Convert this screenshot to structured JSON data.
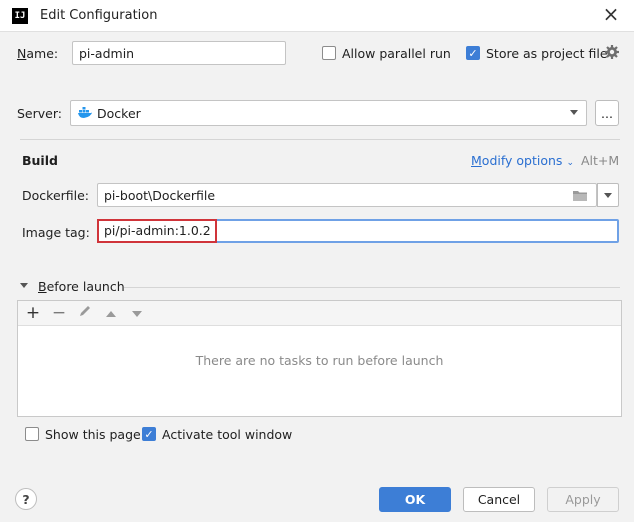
{
  "window": {
    "title": "Edit Configuration",
    "app_icon_text": "IJ"
  },
  "name": {
    "label": "Name:",
    "value": "pi-admin"
  },
  "options": {
    "allow_parallel": {
      "label": "Allow parallel run",
      "checked": false
    },
    "store_as_project_file": {
      "label": "Store as project file",
      "checked": true
    }
  },
  "server": {
    "label": "Server:",
    "value": "Docker",
    "more_label": "..."
  },
  "build": {
    "heading": "Build",
    "modify_options": "Modify options",
    "shortcut": "Alt+M",
    "dockerfile_label": "Dockerfile:",
    "dockerfile_value": "pi-boot\\Dockerfile",
    "image_tag_label": "Image tag:",
    "image_tag_value": "pi/pi-admin:1.0.2"
  },
  "before_launch": {
    "heading": "Before launch",
    "empty_text": "There are no tasks to run before launch"
  },
  "bottom_options": {
    "show_this_page": {
      "label": "Show this page",
      "checked": false
    },
    "activate_tool_window": {
      "label": "Activate tool window",
      "checked": true
    }
  },
  "buttons": {
    "help": "?",
    "ok": "OK",
    "cancel": "Cancel",
    "apply": "Apply"
  },
  "colors": {
    "accent": "#3d7ed6",
    "highlight_border": "#d0343a",
    "link": "#2a6fd1"
  }
}
